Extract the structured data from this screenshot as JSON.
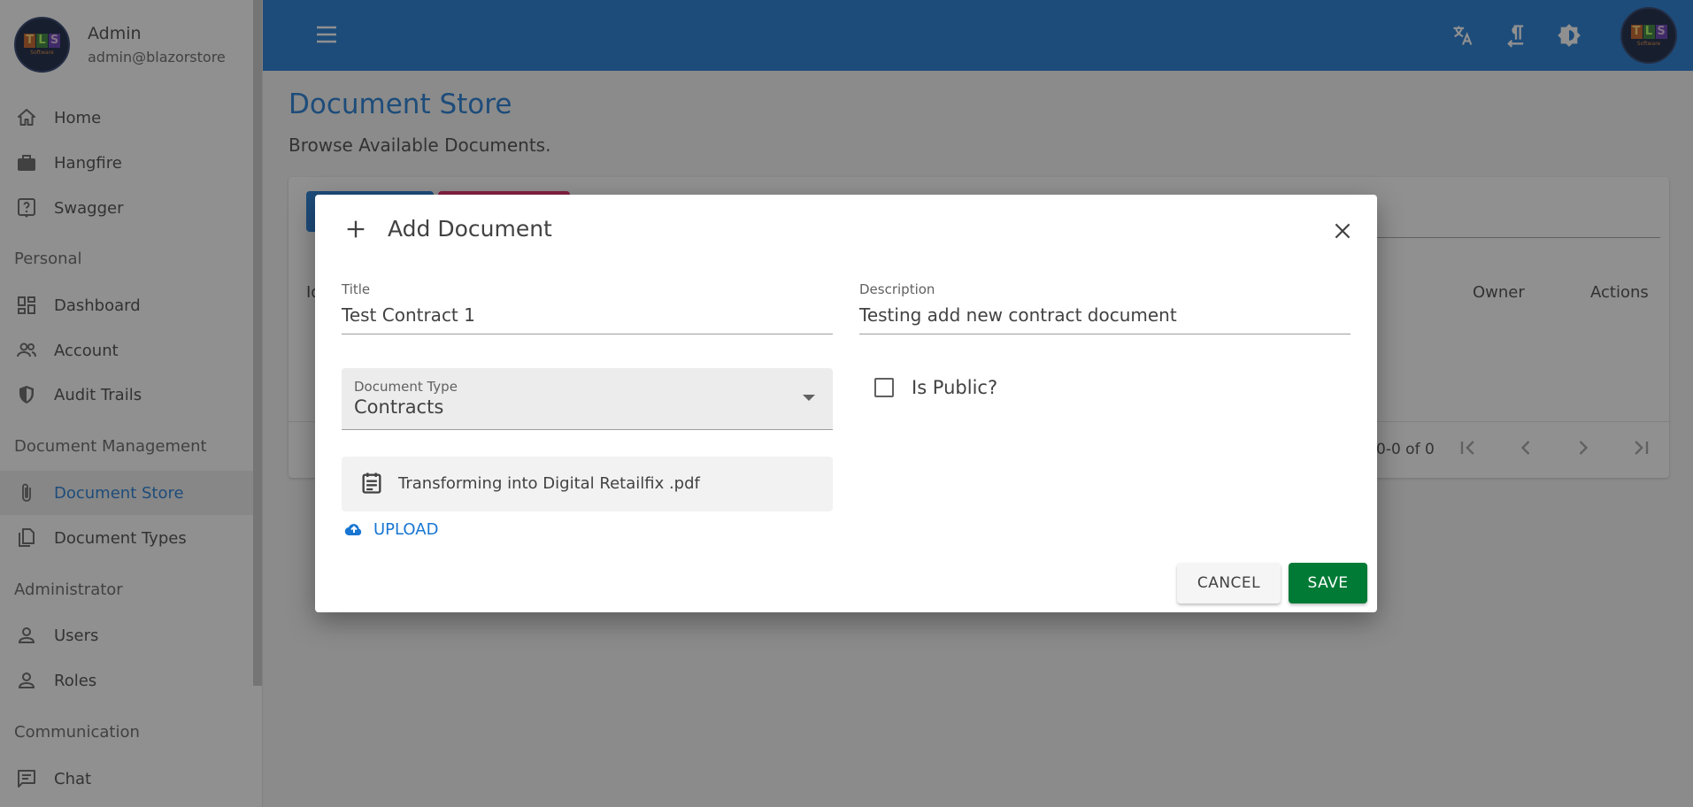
{
  "user": {
    "name": "Admin",
    "email": "admin@blazorstore",
    "logo_letters": [
      "T",
      "L",
      "S"
    ],
    "logo_sub": "Software"
  },
  "sidebar": {
    "top_items": [
      {
        "label": "Home",
        "icon": "home-icon"
      },
      {
        "label": "Hangfire",
        "icon": "briefcase-icon"
      },
      {
        "label": "Swagger",
        "icon": "help-box-icon"
      }
    ],
    "sections": [
      {
        "title": "Personal",
        "items": [
          {
            "label": "Dashboard",
            "icon": "dashboard-icon"
          },
          {
            "label": "Account",
            "icon": "account-icon"
          },
          {
            "label": "Audit Trails",
            "icon": "shield-icon"
          }
        ]
      },
      {
        "title": "Document Management",
        "items": [
          {
            "label": "Document Store",
            "icon": "paperclip-icon",
            "active": true
          },
          {
            "label": "Document Types",
            "icon": "documents-icon"
          }
        ]
      },
      {
        "title": "Administrator",
        "items": [
          {
            "label": "Users",
            "icon": "user-icon"
          },
          {
            "label": "Roles",
            "icon": "user-icon"
          }
        ]
      },
      {
        "title": "Communication",
        "items": [
          {
            "label": "Chat",
            "icon": "chat-icon"
          }
        ]
      }
    ]
  },
  "topbar": {
    "icons": [
      "menu-icon",
      "translate-icon",
      "text-direction-icon",
      "theme-icon"
    ],
    "color": "#1976d2"
  },
  "page": {
    "title": "Document Store",
    "subtitle": "Browse Available Documents.",
    "table": {
      "headers": [
        "Id",
        "Owner",
        "Actions"
      ],
      "pager_text": "0-0 of 0"
    }
  },
  "dialog": {
    "title": "Add Document",
    "fields": {
      "title_label": "Title",
      "title_value": "Test Contract 1",
      "description_label": "Description",
      "description_value": "Testing add new contract document",
      "doc_type_label": "Document Type",
      "doc_type_value": "Contracts",
      "is_public_label": "Is Public?",
      "is_public_checked": false
    },
    "file_name": "Transforming into Digital Retailfix .pdf",
    "upload_label": "UPLOAD",
    "cancel_label": "CANCEL",
    "save_label": "SAVE",
    "save_color": "#007a35"
  }
}
